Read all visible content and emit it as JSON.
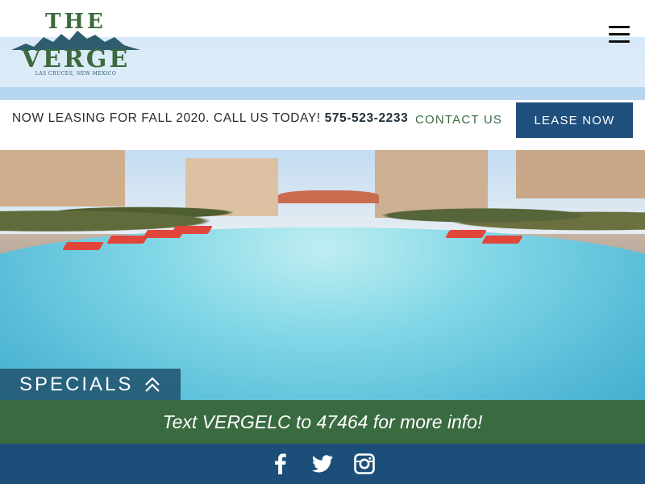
{
  "brand": {
    "logo_top": "THE",
    "logo_main": "VERGE",
    "logo_sub": "LAS CRUCES, NEW MEXICO",
    "color_green": "#3c6a3c",
    "color_blue": "#1f4f7c"
  },
  "header": {
    "menu_icon": "hamburger-menu-icon"
  },
  "lease_bar": {
    "announcement": "NOW LEASING FOR FALL 2020. CALL US TODAY!",
    "phone": "575-523-2233",
    "contact_label": "CONTACT US",
    "lease_button_label": "LEASE NOW"
  },
  "specials": {
    "label": "SPECIALS",
    "icon": "double-chevron-up-icon"
  },
  "info_bar": {
    "text": "Text VERGELC to 47464 for more info!",
    "background": "#3a6a40"
  },
  "social": {
    "icons": [
      "facebook-icon",
      "twitter-icon",
      "instagram-icon"
    ],
    "background": "#1d4e7a"
  }
}
